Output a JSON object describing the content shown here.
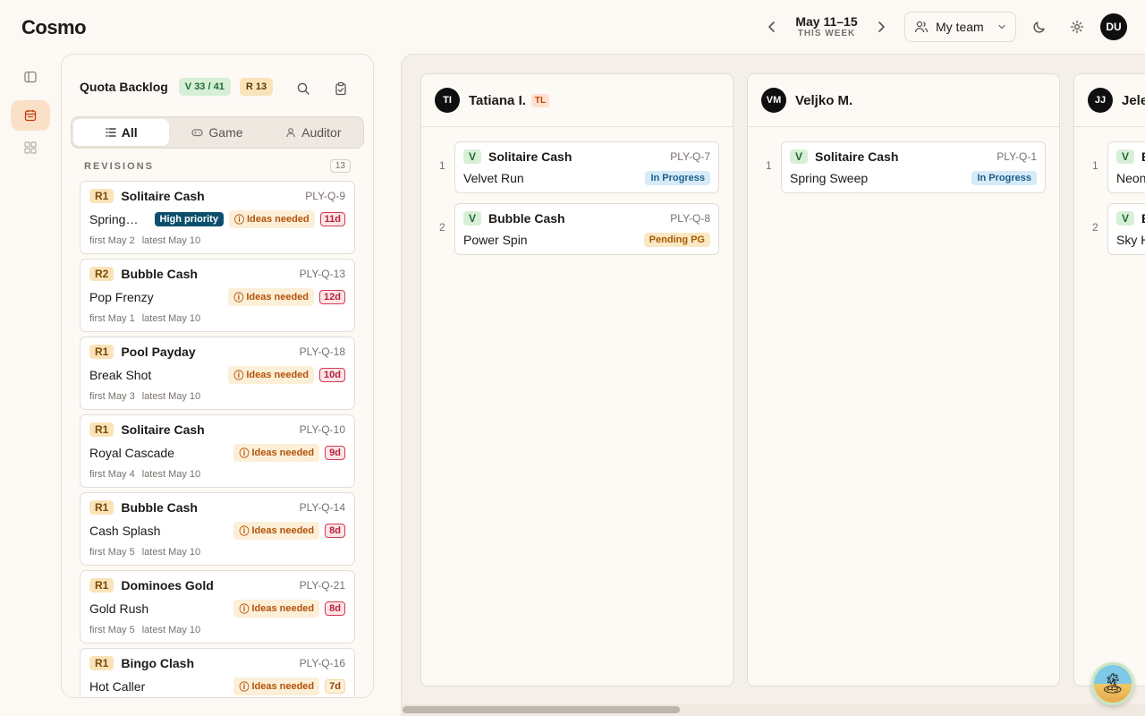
{
  "app": {
    "logo": "Cosmo"
  },
  "header": {
    "week_range": "May 11–15",
    "week_sub": "THIS WEEK",
    "team_label": "My team",
    "user_initials": "DU"
  },
  "backlog": {
    "title": "Quota Backlog",
    "v_badge": "V 33 / 41",
    "r_badge": "R 13",
    "tabs": [
      {
        "label": "All",
        "icon": "list-icon",
        "active": true
      },
      {
        "label": "Game",
        "icon": "gamepad-icon",
        "active": false
      },
      {
        "label": "Auditor",
        "icon": "user-icon",
        "active": false
      }
    ],
    "section_label": "REVISIONS",
    "section_count": "13",
    "cards": [
      {
        "rev": "R1",
        "game": "Solitaire Cash",
        "id": "PLY-Q-9",
        "name": "Spring…",
        "priority": "High priority",
        "ideas": "Ideas needed",
        "days": "11d",
        "first": "first May 2",
        "latest": "latest May 10"
      },
      {
        "rev": "R2",
        "game": "Bubble Cash",
        "id": "PLY-Q-13",
        "name": "Pop Frenzy",
        "priority": "",
        "ideas": "Ideas needed",
        "days": "12d",
        "first": "first May 1",
        "latest": "latest May 10"
      },
      {
        "rev": "R1",
        "game": "Pool Payday",
        "id": "PLY-Q-18",
        "name": "Break Shot",
        "priority": "",
        "ideas": "Ideas needed",
        "days": "10d",
        "first": "first May 3",
        "latest": "latest May 10"
      },
      {
        "rev": "R1",
        "game": "Solitaire Cash",
        "id": "PLY-Q-10",
        "name": "Royal Cascade",
        "priority": "",
        "ideas": "Ideas needed",
        "days": "9d",
        "first": "first May 4",
        "latest": "latest May 10"
      },
      {
        "rev": "R1",
        "game": "Bubble Cash",
        "id": "PLY-Q-14",
        "name": "Cash Splash",
        "priority": "",
        "ideas": "Ideas needed",
        "days": "8d",
        "first": "first May 5",
        "latest": "latest May 10"
      },
      {
        "rev": "R1",
        "game": "Dominoes Gold",
        "id": "PLY-Q-21",
        "name": "Gold Rush",
        "priority": "",
        "ideas": "Ideas needed",
        "days": "8d",
        "first": "first May 5",
        "latest": "latest May 10"
      },
      {
        "rev": "R1",
        "game": "Bingo Clash",
        "id": "PLY-Q-16",
        "name": "Hot Caller",
        "priority": "",
        "ideas": "Ideas needed",
        "days": "7d",
        "first": "",
        "latest": ""
      }
    ]
  },
  "board": {
    "columns": [
      {
        "initials": "TI",
        "name": "Tatiana I.",
        "tag": "TL",
        "tasks": [
          {
            "num": "1",
            "tag": "V",
            "game": "Solitaire Cash",
            "id": "PLY-Q-7",
            "name": "Velvet Run",
            "status": "In Progress",
            "status_type": "progress"
          },
          {
            "num": "2",
            "tag": "V",
            "game": "Bubble Cash",
            "id": "PLY-Q-8",
            "name": "Power Spin",
            "status": "Pending PG",
            "status_type": "pending"
          }
        ]
      },
      {
        "initials": "VM",
        "name": "Veljko M.",
        "tag": "",
        "tasks": [
          {
            "num": "1",
            "tag": "V",
            "game": "Solitaire Cash",
            "id": "PLY-Q-1",
            "name": "Spring Sweep",
            "status": "In Progress",
            "status_type": "progress"
          }
        ]
      },
      {
        "initials": "JJ",
        "name": "Jele",
        "tag": "",
        "tasks": [
          {
            "num": "1",
            "tag": "V",
            "game": "B",
            "id": "",
            "name": "Neon",
            "status": "",
            "status_type": ""
          },
          {
            "num": "2",
            "tag": "V",
            "game": "B",
            "id": "",
            "name": "Sky H",
            "status": "",
            "status_type": ""
          }
        ]
      }
    ]
  }
}
